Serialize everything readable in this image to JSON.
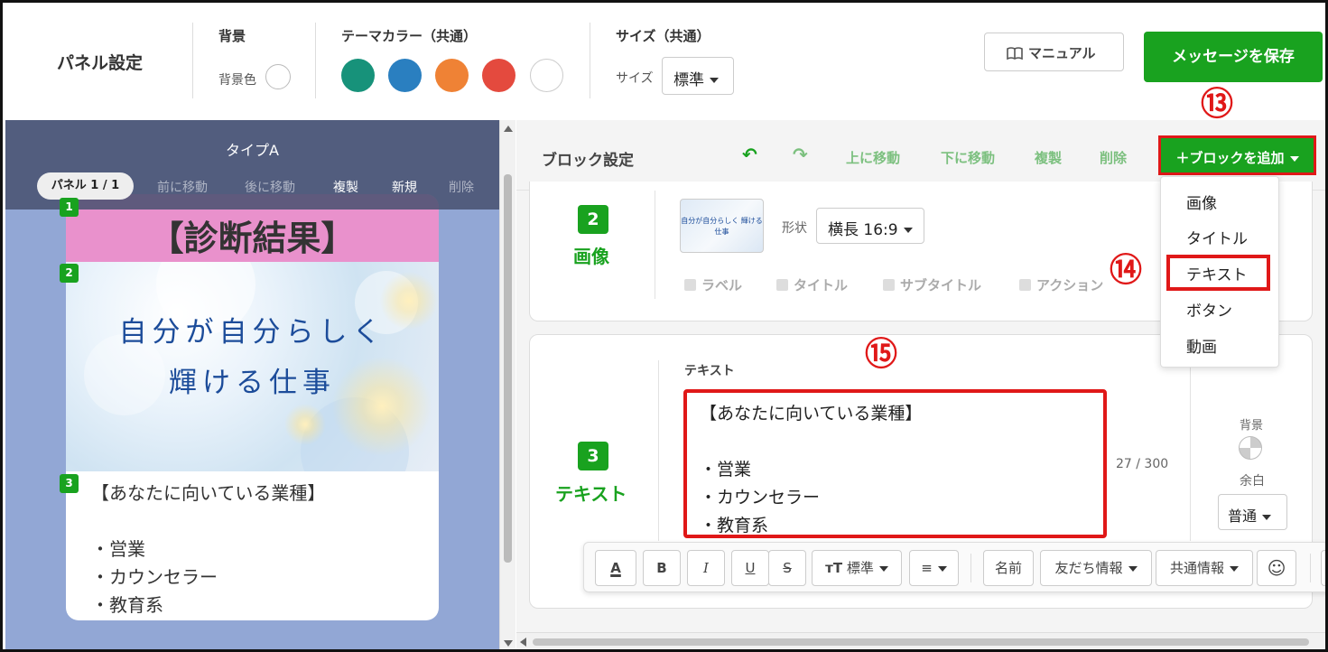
{
  "header": {
    "panel_settings": "パネル設定",
    "background_section": "背景",
    "background_color_label": "背景色",
    "theme_section": "テーマカラー（共通）",
    "theme_colors": [
      "#17927a",
      "#2a7fc0",
      "#ef8235",
      "#e44a3e",
      "#ffffff"
    ],
    "size_section": "サイズ（共通）",
    "size_label": "サイズ",
    "size_value": "標準",
    "manual_button": "マニュアル",
    "save_button": "メッセージを保存"
  },
  "preview": {
    "type_title": "タイプA",
    "panel_pill": "パネル 1 / 1",
    "nav": [
      "前に移動",
      "後に移動",
      "複製",
      "新規",
      "削除"
    ],
    "card_title": "【診断結果】",
    "image_line1": "自分が自分らしく",
    "image_line2": "輝ける仕事",
    "text": "【あなたに向いている業種】\n\n・営業\n・カウンセラー\n・教育系",
    "badges": [
      "1",
      "2",
      "3"
    ]
  },
  "editor": {
    "block_settings": "ブロック設定",
    "toolbar": {
      "undo": "↶",
      "redo": "↷",
      "move_up": "上に移動",
      "move_down": "下に移動",
      "duplicate": "複製",
      "delete": "削除",
      "add_block": "＋ブロックを追加"
    },
    "add_block_menu": [
      "画像",
      "タイトル",
      "テキスト",
      "ボタン",
      "動画"
    ],
    "image_block": {
      "number": "2",
      "type": "画像",
      "thumb_text": "自分が自分らしく 輝ける仕事",
      "shape_label": "形状",
      "shape_value": "横長 16:9",
      "options": [
        "ラベル",
        "タイトル",
        "サブタイトル",
        "アクション"
      ]
    },
    "text_block": {
      "number": "3",
      "type": "テキスト",
      "field_label": "テキスト",
      "value": "【あなたに向いている業種】\n\n・営業\n・カウンセラー\n・教育系",
      "char_count": "27 / 300",
      "bg_label": "背景",
      "margin_label": "余白",
      "margin_value": "普通"
    },
    "format_bar": {
      "font_color": "A",
      "bold": "B",
      "italic": "I",
      "underline": "U",
      "strike": "S",
      "size_icon": "тT",
      "size_value": "標準",
      "align_icon": "≡",
      "name": "名前",
      "friend_info": "友だち情報",
      "common_info": "共通情報",
      "emoji": "☺"
    }
  },
  "annotations": [
    "⑬",
    "⑭",
    "⑮"
  ]
}
